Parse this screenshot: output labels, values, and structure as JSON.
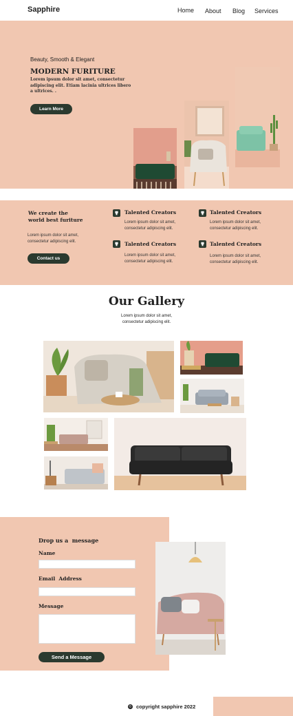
{
  "brand": "Sapphire",
  "nav": {
    "items": [
      "Home",
      "About",
      "Blog",
      "Services"
    ]
  },
  "hero": {
    "tagline": "Beauty, Smooth & Elegant",
    "title": "MODERN FURITURE",
    "body": "Lorem ipsum dolor sit amet, consectetur adipiscing elit. Etiam lacinia ultrices libero a ultrices. .",
    "cta": "Learn More"
  },
  "features": {
    "heading_line1": "We create the",
    "heading_line2": "world best furiture",
    "text": "Lorem ipsum dolor sit amet, consectetur adipiscing elit.",
    "cta": "Contact us",
    "items": [
      {
        "title": "Talented Creators",
        "text_line1": "Lorem ipsum dolor sit amet,",
        "text_line2": "consectetur adipiscing elit."
      },
      {
        "title": "Talented Creators",
        "text_line1": "Lorem ipsum dolor sit amet,",
        "text_line2": "consectetur adipiscing elit."
      },
      {
        "title": "Talented Creators",
        "text_line1": "Lorem ipsum dolor sit amet,",
        "text_line2": "consectetur adipiscing elit."
      },
      {
        "title": "Talented Creators",
        "text_line1": "Lorem ipsum dolor sit amet,",
        "text_line2": "consectetur adipiscing elit."
      }
    ]
  },
  "gallery": {
    "title": "Our Gallery",
    "text_line1": "Lorem ipsum dolor sit amet,",
    "text_line2": "consectetur adipiscing elit."
  },
  "contact": {
    "heading": "Drop us a  message",
    "name_label": "Name",
    "email_label": "Email  Address",
    "message_label": "Message",
    "name_value": "",
    "email_value": "",
    "message_value": "",
    "submit": "Send a Message"
  },
  "footer": {
    "copyright": "copyright sapphire 2022"
  },
  "colors": {
    "peach": "#f1c7b1",
    "dark_green": "#2b3a2f"
  }
}
